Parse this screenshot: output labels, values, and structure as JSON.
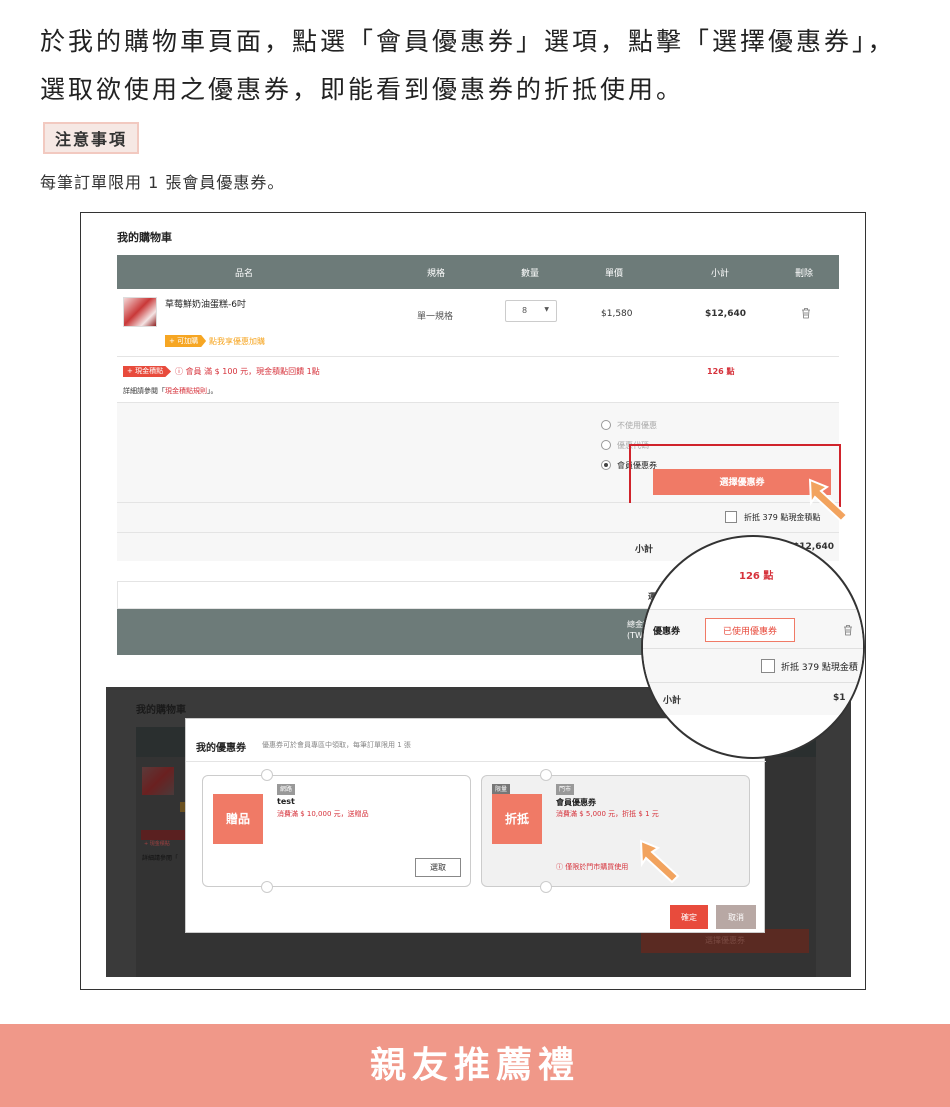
{
  "intro": "於我的購物車頁面，點選「會員優惠券」選項，點擊「選擇優惠券」，選取欲使用之優惠券，即能看到優惠券的折抵使用。",
  "notice": {
    "tag": "注意事項",
    "text": "每筆訂單限用 1 張會員優惠券。"
  },
  "cart": {
    "title": "我的購物車",
    "headers": {
      "name": "品名",
      "spec": "規格",
      "qty": "數量",
      "price": "單價",
      "subtotal": "小計",
      "delete": "刪除"
    },
    "item": {
      "name": "草莓鮮奶油蛋糕-6吋",
      "addon_tag": "+ 可加購",
      "addon_text": "點我享優惠加購",
      "spec": "單一規格",
      "qty": "8",
      "price": "$1,580",
      "subtotal": "$12,640"
    },
    "cash": {
      "tag": "+ 現金積點",
      "info": "ⓘ 會員 滿 $ 100 元，現金積點回饋 1點",
      "detail_prefix": "詳細請參閱「",
      "detail_link": "現金積點規則",
      "detail_suffix": "」。",
      "points": "126 點"
    },
    "options": {
      "none": "不使用優惠",
      "code": "優惠代碼",
      "member": "會員優惠券"
    },
    "select_button": "選擇優惠券",
    "redeem": "折抵 379 點現金積點",
    "subtotal_label": "小計",
    "subtotal_value": "$12,640",
    "shipping_label": "運費",
    "total_label": "總金額",
    "total_unit": "(TWD)"
  },
  "dark": {
    "title": "我的購物車",
    "select_button": "選擇優惠券",
    "tag": "+ 現金積點",
    "detail": "詳細請參閱「"
  },
  "modal": {
    "title": "我的優惠券",
    "subtitle": "優惠券可於會員專區中領取，每筆訂單限用 1 張",
    "coupons": [
      {
        "badge": "贈品",
        "chip": "網路",
        "name": "test",
        "desc": "消費滿 $ 10,000 元，送贈品",
        "button": "選取"
      },
      {
        "badge": "折抵",
        "chip_qty": "限量",
        "chip": "門市",
        "name": "會員優惠券",
        "desc": "消費滿 $ 5,000 元，折抵 $ 1 元",
        "warn": "ⓘ 僅限於門市購買使用"
      }
    ],
    "ok": "確定",
    "cancel": "取消"
  },
  "magnifier": {
    "points": "126 點",
    "label": "優惠券",
    "used": "已使用優惠券",
    "redeem": "折抵 379 點現金積",
    "subtotal_label": "小計",
    "subtotal_value": "$1"
  },
  "footer": "親友推薦禮"
}
